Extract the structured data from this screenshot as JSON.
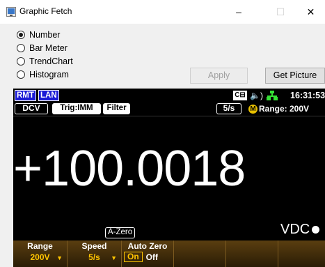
{
  "window": {
    "title": "Graphic Fetch",
    "minimize": "–",
    "maximize": "☐",
    "close": "✕"
  },
  "options": [
    {
      "label": "Number",
      "selected": true
    },
    {
      "label": "Bar Meter",
      "selected": false
    },
    {
      "label": "TrendChart",
      "selected": false
    },
    {
      "label": "Histogram",
      "selected": false
    }
  ],
  "buttons": {
    "apply": "Apply",
    "get_picture": "Get Picture"
  },
  "instrument": {
    "status": {
      "rmt": "RMT",
      "lan": "LAN",
      "cb": "C⊟",
      "speaker": "🔈)",
      "time": "16:31:53"
    },
    "mode": {
      "function": "DCV",
      "trigger": "Trig:IMM",
      "filter": "Filter",
      "rate": "5/s",
      "m_badge": "M",
      "range": "Range:  200V"
    },
    "reading": "+100.0018",
    "azero": "A-Zero",
    "unit": "VDC",
    "softkeys": {
      "range_label": "Range",
      "range_value": "200V",
      "speed_label": "Speed",
      "speed_value": "5/s",
      "autozero_label": "Auto Zero",
      "autozero_on": "On",
      "autozero_off": "Off"
    }
  },
  "colors": {
    "screen_bg": "#000000",
    "tag_blue": "#1b1bd6",
    "softkey_value": "#ffc400",
    "network_green": "#35e035"
  }
}
